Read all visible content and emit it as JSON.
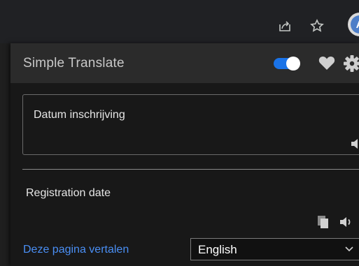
{
  "browser": {
    "share_icon": "share-icon",
    "star_icon": "star-icon",
    "profile_initial": "A"
  },
  "popup": {
    "title": "Simple Translate",
    "toggle_on": true,
    "accent_color": "#1a73e8",
    "heart_icon": "heart-icon",
    "settings_icon": "gear-icon"
  },
  "source": {
    "text": "Datum inschrijving",
    "speaker_icon": "speaker-icon"
  },
  "result": {
    "text": "Registration date",
    "copy_icon": "copy-icon",
    "speaker_icon": "speaker-icon"
  },
  "footer": {
    "translate_page_link": "Deze pagina vertalen",
    "target_language": "English",
    "link_color": "#4a8ff5"
  }
}
